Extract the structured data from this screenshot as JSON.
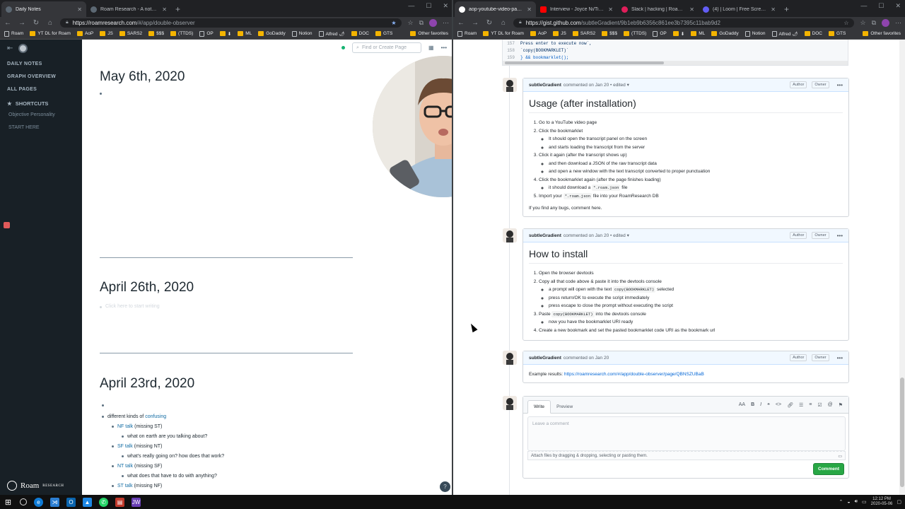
{
  "left": {
    "tabs": [
      {
        "title": "Daily Notes",
        "active": true,
        "color": "#5c6873"
      },
      {
        "title": "Roam Research - A note taking t...",
        "active": false,
        "color": "#5c6873"
      }
    ],
    "url_host": "https://roamresearch.com",
    "url_path": "/#/app/double-observer",
    "bookmarks": [
      "Roam",
      "YT DL for Roam",
      "AoP",
      "JS",
      "SARS2",
      "$$$",
      "(TTDS)",
      "OP",
      "⬇",
      "ML",
      "GoDaddy",
      "Notion",
      "Alfred 🌶",
      "DOC",
      "GTS"
    ],
    "other_bookmarks": "Other favorites",
    "sidebar": {
      "nav": [
        "DAILY NOTES",
        "GRAPH OVERVIEW",
        "ALL PAGES"
      ],
      "shortcuts_title": "SHORTCUTS",
      "shortcuts": [
        "Objective Personality",
        "START HERE"
      ],
      "logo": "Roam",
      "logo_sub": "RESEARCH"
    },
    "search_placeholder": "Find or Create Page",
    "pages": [
      {
        "title": "May 6th, 2020",
        "bullet": ""
      },
      {
        "title": "April 26th, 2020",
        "bullet": "Click here to start writing"
      },
      {
        "title": "April 23rd, 2020"
      }
    ],
    "april23": {
      "l2_pre": "different kinds of ",
      "l2_link": "confusing",
      "nf_link": "NF talk",
      "nf_rest": " (missing ST)",
      "nf_sub": "what on earth are you talking about?",
      "sf_link": "SF talk",
      "sf_rest": " (missing NT)",
      "sf_sub": "what's really going on? how does that work?",
      "nt_link": "NT talk",
      "nt_rest": " (missing SF)",
      "nt_sub": "what does that have to do with anything?",
      "st_link": "ST talk",
      "st_rest": " (missing NF)"
    },
    "help": "?"
  },
  "right": {
    "tabs": [
      {
        "title": "aop-youtube-video-page-to-ro...",
        "active": true,
        "color": "#ffffff"
      },
      {
        "title": "Interview - Joyce Ni/Ti - INFJ Jun...",
        "active": false,
        "color": "#ff0000"
      },
      {
        "title": "Slack | hacking | Roam | 2 new it...",
        "active": false,
        "color": "#e01e5a"
      },
      {
        "title": "(4) | Loom | Free Screen & Video...",
        "active": false,
        "color": "#625df5"
      }
    ],
    "url_host": "https://gist.github.com",
    "url_path": "/subtleGradient/9b1eb9b6356c861ee3b7395c11bab9d2",
    "code": [
      {
        "n": "157",
        "t": "  Press enter to execute now`,",
        "c": "s"
      },
      {
        "n": "158",
        "t": "  `copy(BOOKMARKLET)`",
        "c": "s"
      },
      {
        "n": "159",
        "t": "} && bookmarklet();",
        "c": "k"
      }
    ],
    "comment1": {
      "author": "subtleGradient",
      "meta": "commented on Jan 20 • edited ▾",
      "badge1": "Author",
      "badge2": "Owner",
      "heading": "Usage (after installation)",
      "i1": "Go to a YouTube video page",
      "i2": "Click the bookmarklet",
      "i2a": "It should open the transcript panel on the screen",
      "i2b": "and starts loading the transcript from the server",
      "i3": "Click it again (after the transcript shows up)",
      "i3a": "and then download a JSON of the raw transcript data",
      "i3b": "and open a new window with the text transcript converted to proper punctuation",
      "i4": "Click the bookmarklet again (after the page finishes loading)",
      "i4a_pre": "it should download a ",
      "i4a_code": "*.roam.json",
      "i4a_post": " file",
      "i5_pre": "Import your ",
      "i5_code": "*.roam.json",
      "i5_post": " file into your RoamResearch DB",
      "footer": "If you find any bugs, comment here."
    },
    "comment2": {
      "author": "subtleGradient",
      "meta": "commented on Jan 20 • edited ▾",
      "badge1": "Author",
      "badge2": "Owner",
      "heading": "How to install",
      "i1": "Open the browser devtools",
      "i2": "Copy all that code above & paste it into the devtools console",
      "i2a_pre": "a prompt will open with the text ",
      "i2a_code": "copy(BOOKMARKLET)",
      "i2a_post": " selected",
      "i2b": "press return/OK to execute the script immediately",
      "i2c": "press escape to close the prompt without executing the script",
      "i3_pre": "Paste ",
      "i3_code": "copy(BOOKMARKLET)",
      "i3_post": " into the devtools console",
      "i3a": "now you have the bookmarklet URI ready",
      "i4": "Create a new bookmark and set the pasted bookmarklet code URI as the bookmark url"
    },
    "comment3": {
      "author": "subtleGradient",
      "meta": "commented on Jan 20",
      "badge1": "Author",
      "badge2": "Owner",
      "label": "Example results: ",
      "link": "https://roamresearch.com/#/app/double-observer/page/QBNSZUBaB"
    },
    "editor": {
      "tab_write": "Write",
      "tab_preview": "Preview",
      "placeholder": "Leave a comment",
      "attach": "Attach files by dragging & dropping, selecting or pasting them.",
      "submit": "Comment"
    }
  },
  "taskbar": {
    "time": "12:12 PM",
    "date": "2020-05-06"
  }
}
